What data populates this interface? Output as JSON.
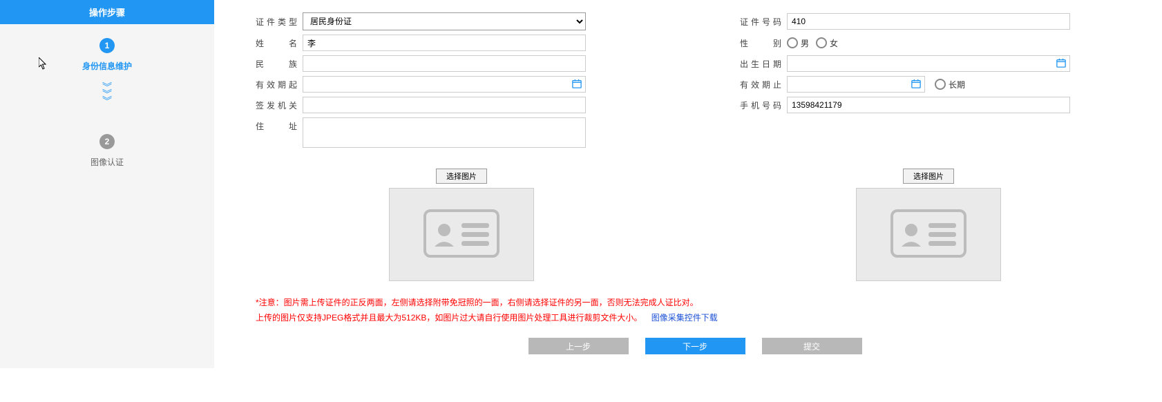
{
  "sidebar": {
    "header": "操作步骤",
    "step1_num": "1",
    "step1_label": "身份信息维护",
    "step2_num": "2",
    "step2_label": "图像认证"
  },
  "form": {
    "id_type_label": "证件类型",
    "id_type_value": "居民身份证",
    "id_number_label": "证件号码",
    "id_number_value": "410",
    "name_label": "姓    名",
    "name_value": "李",
    "gender_label": "性    别",
    "gender_male": "男",
    "gender_female": "女",
    "ethnicity_label": "民    族",
    "ethnicity_value": "",
    "birth_label": "出生日期",
    "birth_value": "",
    "valid_from_label": "有效期起",
    "valid_from_value": "",
    "valid_to_label": "有效期止",
    "valid_to_value": "",
    "long_term_label": "长期",
    "issuer_label": "签发机关",
    "issuer_value": "",
    "phone_label": "手机号码",
    "phone_value": "13598421179",
    "address_label": "住    址",
    "address_value": ""
  },
  "upload": {
    "choose_label": "选择图片"
  },
  "notes": {
    "line1": "*注意：图片需上传证件的正反两面，左侧请选择附带免冠照的一面，右侧请选择证件的另一面，否则无法完成人证比对。",
    "line2": "上传的图片仅支持JPEG格式并且最大为512KB，如图片过大请自行使用图片处理工具进行裁剪文件大小。",
    "link": "图像采集控件下载"
  },
  "buttons": {
    "prev": "上一步",
    "next": "下一步",
    "submit": "提交"
  }
}
